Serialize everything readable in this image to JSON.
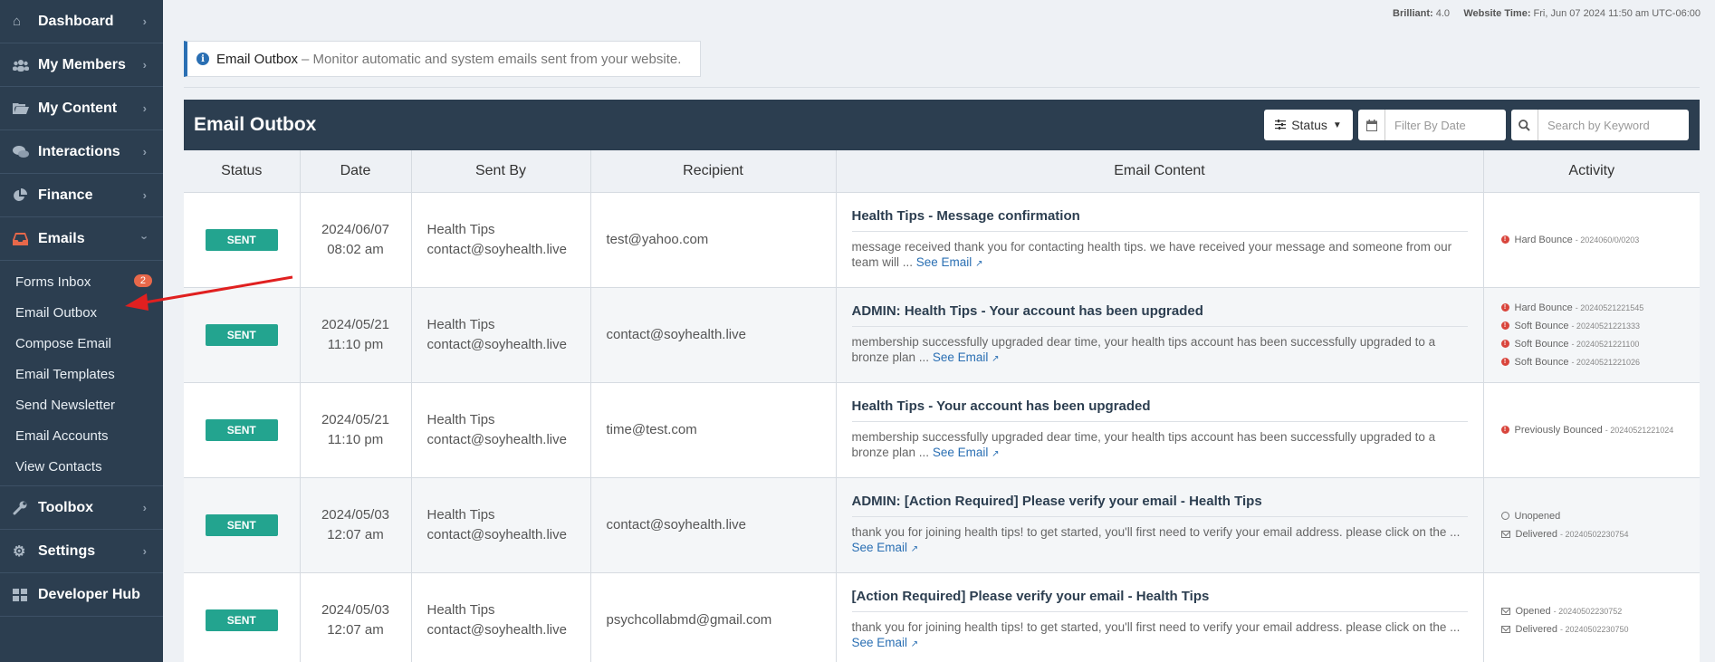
{
  "sidebar": {
    "items": [
      {
        "label": "Dashboard",
        "icon": "home-icon"
      },
      {
        "label": "My Members",
        "icon": "users-icon"
      },
      {
        "label": "My Content",
        "icon": "folder-icon"
      },
      {
        "label": "Interactions",
        "icon": "chat-icon"
      },
      {
        "label": "Finance",
        "icon": "pie-chart-icon"
      },
      {
        "label": "Emails",
        "icon": "inbox-icon"
      }
    ],
    "email_submenu": [
      {
        "label": "Forms Inbox",
        "badge": "2"
      },
      {
        "label": "Email Outbox"
      },
      {
        "label": "Compose Email"
      },
      {
        "label": "Email Templates"
      },
      {
        "label": "Send Newsletter"
      },
      {
        "label": "Email Accounts"
      },
      {
        "label": "View Contacts"
      }
    ],
    "bottom_items": [
      {
        "label": "Toolbox",
        "icon": "wrench-icon"
      },
      {
        "label": "Settings",
        "icon": "gear-icon"
      },
      {
        "label": "Developer Hub",
        "icon": "grid-icon"
      }
    ]
  },
  "topbar": {
    "version_label": "Brilliant:",
    "version_value": "4.0",
    "time_label": "Website Time:",
    "time_value": "Fri, Jun 07 2024 11:50 am UTC-06:00"
  },
  "infobox": {
    "title": "Email Outbox",
    "desc": "– Monitor automatic and system emails sent from your website."
  },
  "panel": {
    "title": "Email Outbox",
    "status_label": "Status",
    "date_placeholder": "Filter By Date",
    "search_placeholder": "Search by Keyword"
  },
  "columns": [
    "Status",
    "Date",
    "Sent By",
    "Recipient",
    "Email Content",
    "Activity"
  ],
  "rows": [
    {
      "status": "SENT",
      "date": "2024/06/07",
      "time": "08:02 am",
      "sender_name": "Health Tips",
      "sender_email": "contact@soyhealth.live",
      "recipient": "test@yahoo.com",
      "subject": "Health Tips - Message confirmation",
      "excerpt": "message received thank you for contacting health tips. we have received your message and someone from our team will ...",
      "see_email": "See Email",
      "activity": [
        {
          "type": "error",
          "text": "Hard Bounce",
          "stamp": "- 2024060/0/0203"
        }
      ]
    },
    {
      "status": "SENT",
      "date": "2024/05/21",
      "time": "11:10 pm",
      "sender_name": "Health Tips",
      "sender_email": "contact@soyhealth.live",
      "recipient": "contact@soyhealth.live",
      "subject": "ADMIN: Health Tips - Your account has been upgraded",
      "excerpt": "membership successfully upgraded dear time, your health tips account has been successfully upgraded to a bronze plan ...",
      "see_email": "See Email",
      "activity": [
        {
          "type": "error",
          "text": "Hard Bounce",
          "stamp": "- 20240521221545"
        },
        {
          "type": "error",
          "text": "Soft Bounce",
          "stamp": "- 20240521221333"
        },
        {
          "type": "error",
          "text": "Soft Bounce",
          "stamp": "- 20240521221100"
        },
        {
          "type": "error",
          "text": "Soft Bounce",
          "stamp": "- 20240521221026"
        }
      ]
    },
    {
      "status": "SENT",
      "date": "2024/05/21",
      "time": "11:10 pm",
      "sender_name": "Health Tips",
      "sender_email": "contact@soyhealth.live",
      "recipient": "time@test.com",
      "subject": "Health Tips - Your account has been upgraded",
      "excerpt": "membership successfully upgraded dear time, your health tips account has been successfully upgraded to a bronze plan ...",
      "see_email": "See Email",
      "activity": [
        {
          "type": "error",
          "text": "Previously Bounced",
          "stamp": "- 20240521221024"
        }
      ]
    },
    {
      "status": "SENT",
      "date": "2024/05/03",
      "time": "12:07 am",
      "sender_name": "Health Tips",
      "sender_email": "contact@soyhealth.live",
      "recipient": "contact@soyhealth.live",
      "subject": "ADMIN: [Action Required] Please verify your email - Health Tips",
      "excerpt": "thank you for joining health tips! to get started, you'll first need to verify your email address. please click on the ...",
      "see_email": "See Email",
      "activity": [
        {
          "type": "open",
          "text": "Unopened",
          "stamp": ""
        },
        {
          "type": "mail",
          "text": "Delivered",
          "stamp": "- 20240502230754"
        }
      ]
    },
    {
      "status": "SENT",
      "date": "2024/05/03",
      "time": "12:07 am",
      "sender_name": "Health Tips",
      "sender_email": "contact@soyhealth.live",
      "recipient": "psychcollabmd@gmail.com",
      "subject": "[Action Required] Please verify your email - Health Tips",
      "excerpt": "thank you for joining health tips! to get started, you'll first need to verify your email address. please click on the ...",
      "see_email": "See Email",
      "activity": [
        {
          "type": "mailopen",
          "text": "Opened",
          "stamp": "- 20240502230752"
        },
        {
          "type": "mail",
          "text": "Delivered",
          "stamp": "- 20240502230750"
        }
      ]
    }
  ],
  "colors": {
    "sidebar": "#2c3e50",
    "sent": "#23a48f",
    "link": "#2a6fb3",
    "arrow": "#e02020"
  }
}
